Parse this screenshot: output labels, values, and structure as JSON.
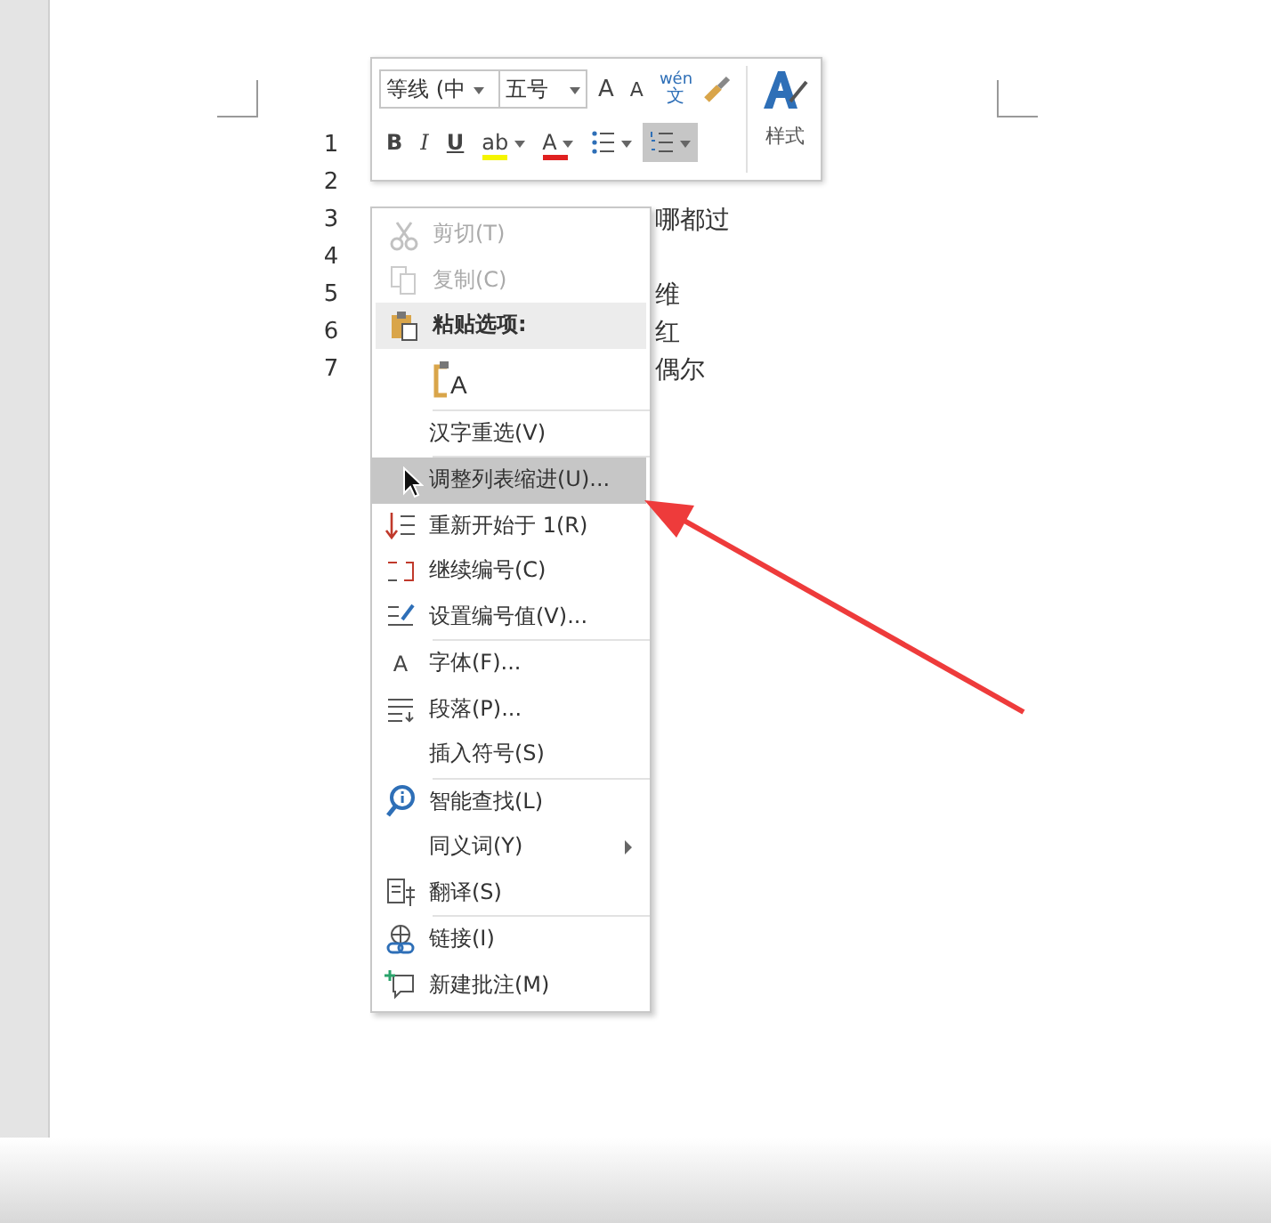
{
  "document": {
    "lines": [
      {
        "number": "1"
      },
      {
        "number": "2"
      },
      {
        "number": "3",
        "text": "哪都过"
      },
      {
        "number": "4"
      },
      {
        "number": "5",
        "text": "维"
      },
      {
        "number": "6",
        "text": "红"
      },
      {
        "number": "7",
        "text": "偶尔"
      }
    ]
  },
  "mini_toolbar": {
    "font": "等线 (中",
    "size": "五号",
    "grow": "A",
    "shrink": "A",
    "phonetic_top": "wén",
    "phonetic_bottom": "文",
    "styles": "样式",
    "format_buttons": [
      {
        "kind": "bold",
        "label": "B",
        "selected": false
      },
      {
        "kind": "italic",
        "label": "I",
        "selected": false
      },
      {
        "kind": "underline",
        "label": "U",
        "selected": false
      },
      {
        "kind": "highlight",
        "label": "ab",
        "selected": false
      },
      {
        "kind": "font-color",
        "label": "A",
        "selected": false
      },
      {
        "kind": "bullets",
        "selected": false
      },
      {
        "kind": "numbering",
        "selected": true
      }
    ]
  },
  "context_menu": {
    "groups": [
      {
        "items": [
          {
            "kind": "item",
            "label": "剪切(T)",
            "disabled": true,
            "selected": false
          },
          {
            "kind": "item",
            "label": "复制(C)",
            "disabled": true,
            "selected": false
          },
          {
            "kind": "header",
            "label": "粘贴选项:"
          },
          {
            "kind": "paste-option",
            "label": "A"
          }
        ]
      },
      {
        "items": [
          {
            "kind": "item",
            "label": "汉字重选(V)",
            "disabled": false,
            "selected": false
          }
        ]
      },
      {
        "items": [
          {
            "kind": "item",
            "label": "调整列表缩进(U)...",
            "disabled": false,
            "selected": true
          },
          {
            "kind": "item",
            "label": "重新开始于 1(R)",
            "disabled": false,
            "selected": false
          },
          {
            "kind": "item",
            "label": "继续编号(C)",
            "disabled": false,
            "selected": false
          },
          {
            "kind": "item",
            "label": "设置编号值(V)...",
            "disabled": false,
            "selected": false
          }
        ]
      },
      {
        "items": [
          {
            "kind": "item",
            "label": "字体(F)...",
            "icon_text": "A",
            "disabled": false,
            "selected": false
          },
          {
            "kind": "item",
            "label": "段落(P)...",
            "disabled": false,
            "selected": false
          },
          {
            "kind": "item",
            "label": "插入符号(S)",
            "disabled": false,
            "selected": false
          }
        ]
      },
      {
        "items": [
          {
            "kind": "item",
            "label": "智能查找(L)",
            "disabled": false,
            "selected": false
          },
          {
            "kind": "item",
            "label": "同义词(Y)",
            "submenu": true,
            "disabled": false,
            "selected": false
          },
          {
            "kind": "item",
            "label": "翻译(S)",
            "disabled": false,
            "selected": false
          }
        ]
      },
      {
        "items": [
          {
            "kind": "item",
            "label": "链接(I)",
            "disabled": false,
            "selected": false
          },
          {
            "kind": "item",
            "label": "新建批注(M)",
            "disabled": false,
            "selected": false
          }
        ]
      }
    ]
  }
}
